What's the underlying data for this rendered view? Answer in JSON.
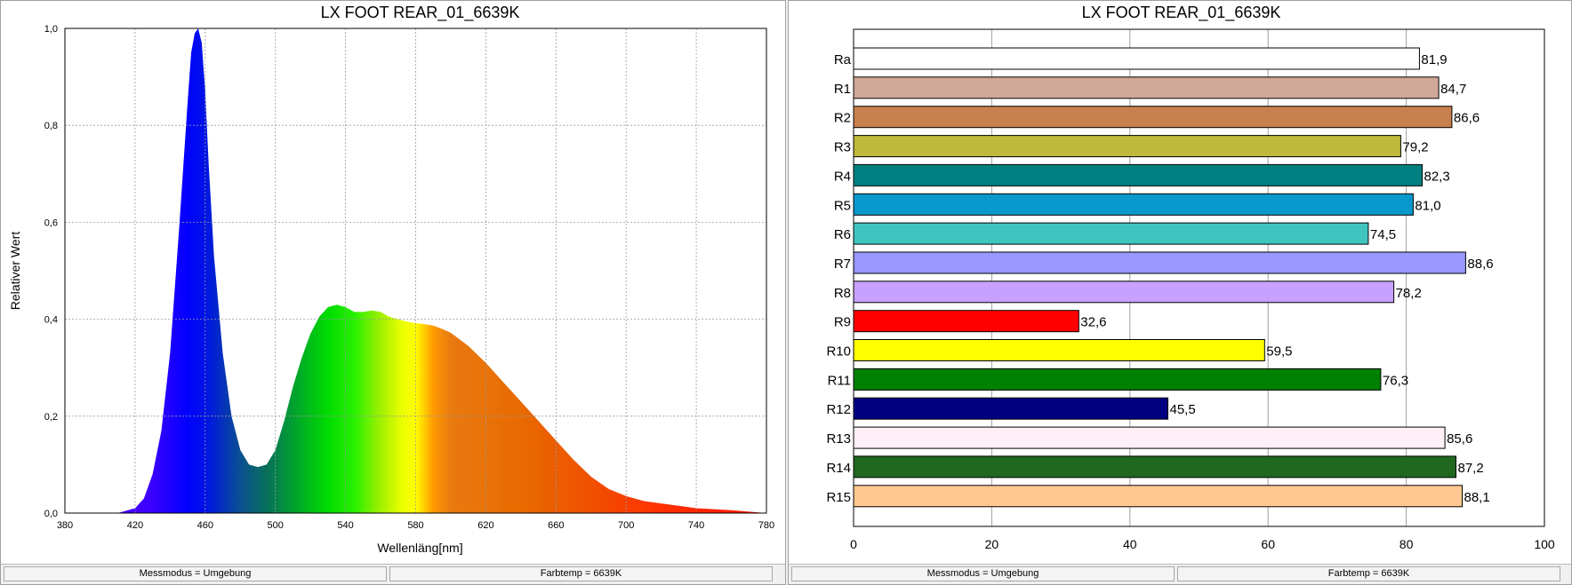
{
  "spectrum_panel": {
    "title": "LX FOOT REAR_01_6639K",
    "status": {
      "messmodus": "Messmodus = Umgebung",
      "farbtemp": "Farbtemp = 6639K"
    }
  },
  "cri_panel": {
    "title": "LX FOOT REAR_01_6639K",
    "status": {
      "messmodus": "Messmodus = Umgebung",
      "farbtemp": "Farbtemp = 6639K"
    }
  },
  "chart_data": [
    {
      "type": "area",
      "title": "LX FOOT REAR_01_6639K",
      "xlabel": "Wellenläng[nm]",
      "ylabel": "Relativer Wert",
      "xlim": [
        380,
        780
      ],
      "ylim": [
        0,
        1.0
      ],
      "x_ticks": [
        "380",
        "420",
        "460",
        "500",
        "540",
        "580",
        "620",
        "660",
        "700",
        "740",
        "780"
      ],
      "y_ticks": [
        "0,0",
        "0,2",
        "0,4",
        "0,6",
        "0,8",
        "1,0"
      ],
      "fill": "wavelength spectral colors",
      "grid": true,
      "series": [
        {
          "x": [
            380,
            400,
            410,
            420,
            425,
            430,
            435,
            440,
            445,
            450,
            452,
            454,
            456,
            458,
            460,
            462,
            465,
            470,
            475,
            480,
            485,
            490,
            495,
            500,
            505,
            510,
            515,
            520,
            525,
            530,
            535,
            540,
            545,
            550,
            555,
            560,
            565,
            570,
            575,
            580,
            585,
            590,
            595,
            600,
            610,
            620,
            630,
            640,
            650,
            660,
            670,
            680,
            690,
            700,
            710,
            720,
            730,
            740,
            750,
            760,
            770,
            780
          ],
          "values": [
            0.0,
            0.0,
            0.0,
            0.01,
            0.03,
            0.08,
            0.17,
            0.33,
            0.58,
            0.85,
            0.95,
            0.99,
            1.0,
            0.97,
            0.87,
            0.72,
            0.53,
            0.33,
            0.2,
            0.13,
            0.1,
            0.095,
            0.1,
            0.13,
            0.19,
            0.26,
            0.32,
            0.37,
            0.405,
            0.425,
            0.43,
            0.425,
            0.415,
            0.415,
            0.418,
            0.415,
            0.405,
            0.4,
            0.395,
            0.392,
            0.39,
            0.387,
            0.38,
            0.372,
            0.345,
            0.31,
            0.27,
            0.23,
            0.19,
            0.15,
            0.11,
            0.075,
            0.05,
            0.035,
            0.025,
            0.02,
            0.015,
            0.01,
            0.008,
            0.006,
            0.003,
            0.0
          ]
        }
      ]
    },
    {
      "type": "bar",
      "orientation": "horizontal",
      "title": "LX FOOT REAR_01_6639K",
      "xlim": [
        0,
        100
      ],
      "x_ticks": [
        "0",
        "20",
        "40",
        "60",
        "80",
        "100"
      ],
      "grid": true,
      "categories": [
        "Ra",
        "R1",
        "R2",
        "R3",
        "R4",
        "R5",
        "R6",
        "R7",
        "R8",
        "R9",
        "R10",
        "R11",
        "R12",
        "R13",
        "R14",
        "R15"
      ],
      "values": [
        81.9,
        84.7,
        86.6,
        79.2,
        82.3,
        81.0,
        74.5,
        88.6,
        78.2,
        32.6,
        59.5,
        76.3,
        45.5,
        85.6,
        87.2,
        88.1
      ],
      "value_labels": [
        "81,9",
        "84,7",
        "86,6",
        "79,2",
        "82,3",
        "81,0",
        "74,5",
        "88,6",
        "78,2",
        "32,6",
        "59,5",
        "76,3",
        "45,5",
        "85,6",
        "87,2",
        "88,1"
      ],
      "colors": [
        "#ffffff",
        "#d0a898",
        "#c8804f",
        "#c0b83a",
        "#008080",
        "#0898cc",
        "#40c4c0",
        "#9898ff",
        "#c8a0ff",
        "#ff0000",
        "#ffff00",
        "#008000",
        "#000080",
        "#fff0f8",
        "#206820",
        "#ffc890"
      ]
    }
  ]
}
